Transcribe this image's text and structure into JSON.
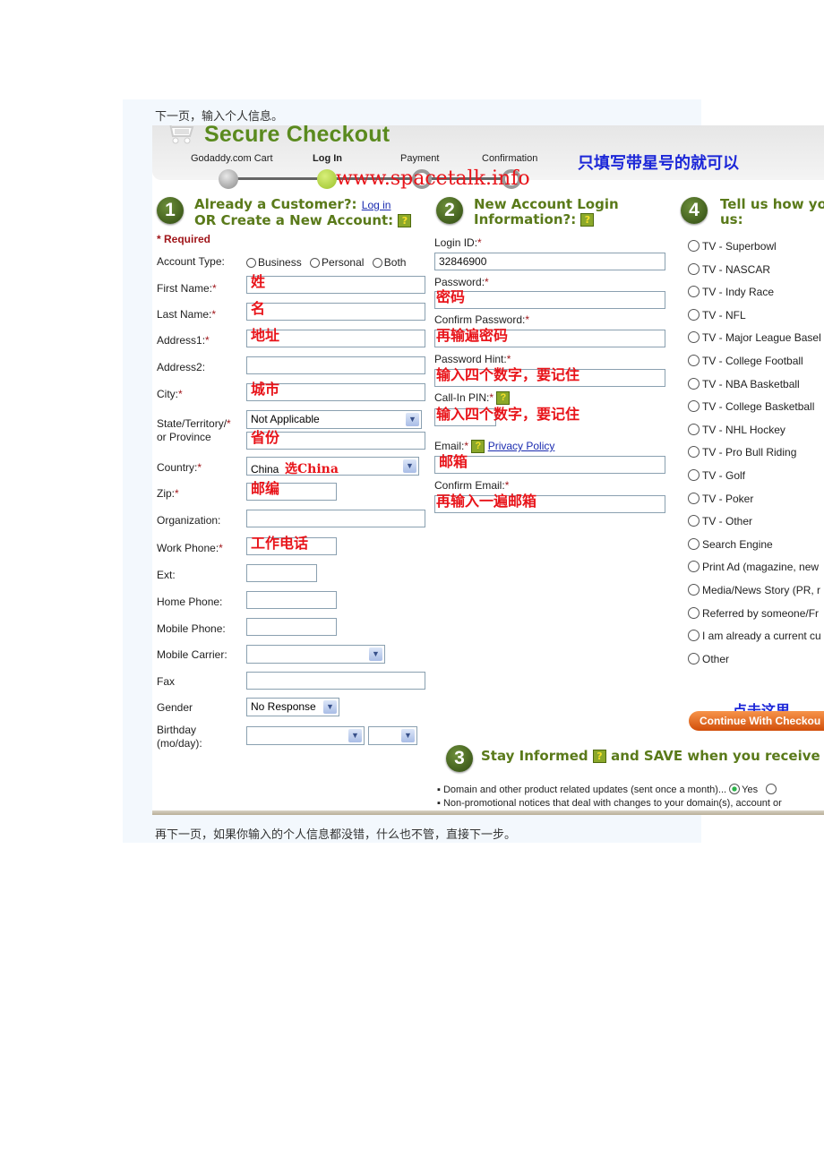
{
  "captions": {
    "top": "下一页，输入个人信息。",
    "bottom": "再下一页，如果你输入的个人信息都没错，什么也不管，直接下一步。"
  },
  "header": {
    "brand": "Secure Checkout",
    "steps": [
      "Godaddy.com Cart",
      "Log In",
      "Payment",
      "Confirmation"
    ],
    "active_step": "Log In",
    "watermark": "www.spacetalk.info",
    "note": "只填写带星号的就可以"
  },
  "section1": {
    "number": "1",
    "title_line1": "Already a Customer?:",
    "login_link": "Log in",
    "title_line2": "OR Create a New Account:",
    "required_note": "* Required",
    "account_type": {
      "label": "Account Type:",
      "options": [
        "Business",
        "Personal",
        "Both"
      ]
    },
    "fields": {
      "first_name": {
        "label": "First Name:",
        "value": "姓"
      },
      "last_name": {
        "label": "Last Name:",
        "value": "名"
      },
      "address1": {
        "label": "Address1:",
        "value": "地址"
      },
      "address2": {
        "label": "Address2:",
        "value": ""
      },
      "city": {
        "label": "City:",
        "value": "城市"
      },
      "state": {
        "label_line1": "State/Territory/",
        "label_line2": "or Province",
        "select_value": "Not Applicable",
        "value": "省份"
      },
      "country": {
        "label": "Country:",
        "select_value": "China",
        "annotation": "选China"
      },
      "zip": {
        "label": "Zip:",
        "value": "邮编"
      },
      "organization": {
        "label": "Organization:",
        "value": ""
      },
      "work_phone": {
        "label": "Work Phone:",
        "value": "工作电话"
      },
      "ext": {
        "label": "Ext:",
        "value": ""
      },
      "home_phone": {
        "label": "Home Phone:",
        "value": ""
      },
      "mobile_phone": {
        "label": "Mobile Phone:",
        "value": ""
      },
      "mobile_carrier": {
        "label": "Mobile Carrier:",
        "select_value": ""
      },
      "fax": {
        "label": "Fax",
        "value": ""
      },
      "gender": {
        "label": "Gender",
        "select_value": "No Response"
      },
      "birthday": {
        "label_line1": "Birthday",
        "label_line2": "(mo/day):",
        "month": "",
        "day": ""
      }
    }
  },
  "section2": {
    "number": "2",
    "title_line1": "New Account Login",
    "title_line2": "Information?:",
    "fields": {
      "login_id": {
        "label": "Login ID:",
        "value": "32846900"
      },
      "password": {
        "label": "Password:",
        "value": "密码"
      },
      "confirm_password": {
        "label": "Confirm Password:",
        "value": "再输遍密码"
      },
      "password_hint": {
        "label": "Password Hint:",
        "value": "输入四个数字，要记住"
      },
      "call_in_pin": {
        "label": "Call-In PIN:",
        "value": "输入四个数字，要记住"
      },
      "email": {
        "label": "Email:",
        "privacy_link": "Privacy Policy",
        "value": "邮箱"
      },
      "confirm_email": {
        "label": "Confirm Email:",
        "value": "再输入一遍邮箱"
      }
    }
  },
  "section4": {
    "number": "4",
    "title_line1": "Tell us how you",
    "title_line2": "us:",
    "options": [
      "TV - Superbowl",
      "TV - NASCAR",
      "TV - Indy Race",
      "TV - NFL",
      "TV - Major League Basel",
      "TV - College Football",
      "TV - NBA Basketball",
      "TV - College Basketball",
      "TV - NHL Hockey",
      "TV - Pro Bull Riding",
      "TV - Golf",
      "TV - Poker",
      "TV - Other",
      "Search Engine",
      "Print Ad (magazine, new",
      "Media/News Story (PR, r",
      "Referred by someone/Fr",
      "I am already a current cu",
      "Other"
    ],
    "click_note": "点击这里",
    "continue_button": "Continue With Checkou"
  },
  "section3": {
    "number": "3",
    "title_a": "Stay Informed",
    "title_b": "and SAVE when you receive em",
    "bullets": [
      "▪ Domain and other product related updates (sent once a month)...",
      "▪ Non-promotional notices that deal with changes to your domain(s), account or"
    ],
    "yes_label": "Yes",
    "yes_selected": true
  },
  "colors": {
    "brand_green": "#5a8a1e",
    "annotation_red": "#e8141a",
    "annotation_blue": "#1c27d8",
    "required_red": "#a0161a",
    "button_orange": "#e56a1e"
  }
}
